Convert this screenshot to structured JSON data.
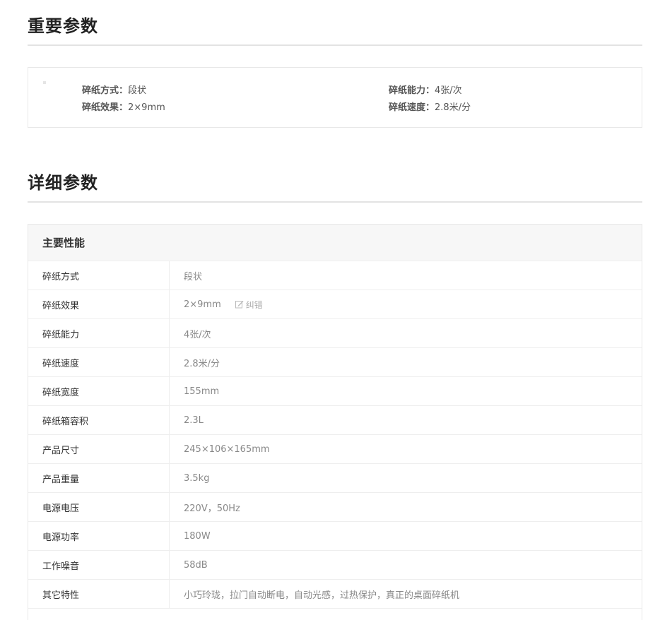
{
  "key_section": {
    "title": "重要参数",
    "items": [
      {
        "label": "碎纸方式：",
        "value": "段状"
      },
      {
        "label": "碎纸效果：",
        "value": "2×9mm"
      },
      {
        "label": "碎纸能力：",
        "value": "4张/次"
      },
      {
        "label": "碎纸速度：",
        "value": "2.8米/分"
      }
    ]
  },
  "detail_section": {
    "title": "详细参数",
    "group_title": "主要性能",
    "correct_label": "纠错",
    "rows": [
      {
        "name": "碎纸方式",
        "value": "段状"
      },
      {
        "name": "碎纸效果",
        "value": "2×9mm"
      },
      {
        "name": "碎纸能力",
        "value": "4张/次"
      },
      {
        "name": "碎纸速度",
        "value": "2.8米/分"
      },
      {
        "name": "碎纸宽度",
        "value": "155mm"
      },
      {
        "name": "碎纸箱容积",
        "value": "2.3L"
      },
      {
        "name": "产品尺寸",
        "value": "245×106×165mm"
      },
      {
        "name": "产品重量",
        "value": "3.5kg"
      },
      {
        "name": "电源电压",
        "value": "220V，50Hz"
      },
      {
        "name": "电源功率",
        "value": "180W"
      },
      {
        "name": "工作噪音",
        "value": "58dB"
      },
      {
        "name": "其它特性",
        "value": "小巧玲珑，拉门自动断电，自动光感，过热保护，真正的桌面碎纸机"
      }
    ]
  }
}
